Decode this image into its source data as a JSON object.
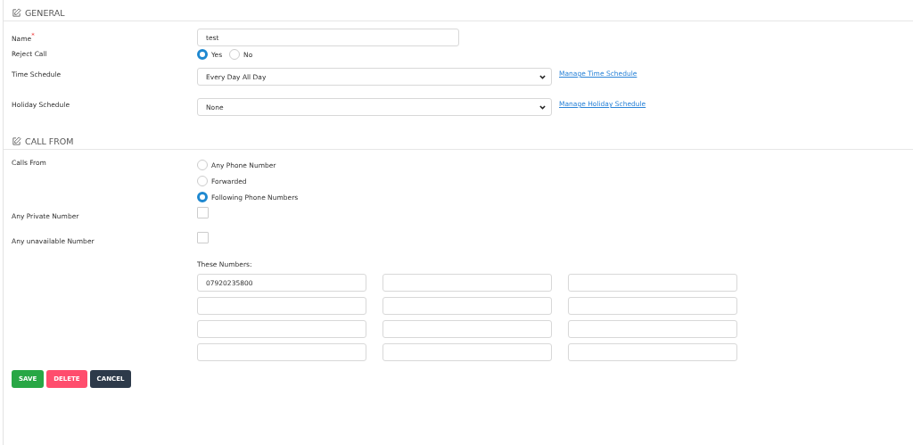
{
  "sections": [
    {
      "title": "GENERAL",
      "fields": [
        {
          "kind": "text",
          "label": "Name",
          "required_mark": "*",
          "value": "test"
        },
        {
          "kind": "radio_inline",
          "label": "Reject Call",
          "options": [
            {
              "label": "Yes",
              "selected": true
            },
            {
              "label": "No",
              "selected": false
            }
          ]
        },
        {
          "kind": "select",
          "label": "Time Schedule",
          "value": "Every Day All Day",
          "link": "Manage Time Schedule"
        },
        {
          "kind": "select",
          "label": "Holiday Schedule",
          "value": "None",
          "link": "Manage Holiday Schedule"
        }
      ]
    },
    {
      "title": "CALL FROM",
      "fields": [
        {
          "kind": "radio_list",
          "label": "Calls From",
          "options": [
            {
              "label": "Any Phone Number",
              "selected": false
            },
            {
              "label": "Forwarded",
              "selected": false
            },
            {
              "label": "Following Phone Numbers",
              "selected": true
            }
          ]
        },
        {
          "kind": "checkbox",
          "label": "Any Private Number",
          "checked": false
        },
        {
          "kind": "checkbox",
          "label": "Any unavailable Number",
          "checked": false
        },
        {
          "kind": "numbers",
          "label": "These Numbers:",
          "values": [
            "07920235800"
          ]
        }
      ]
    }
  ],
  "buttons": [
    {
      "label": "SAVE",
      "kind": "success"
    },
    {
      "label": "DELETE",
      "kind": "danger"
    },
    {
      "label": "CANCEL",
      "kind": "dark"
    }
  ]
}
